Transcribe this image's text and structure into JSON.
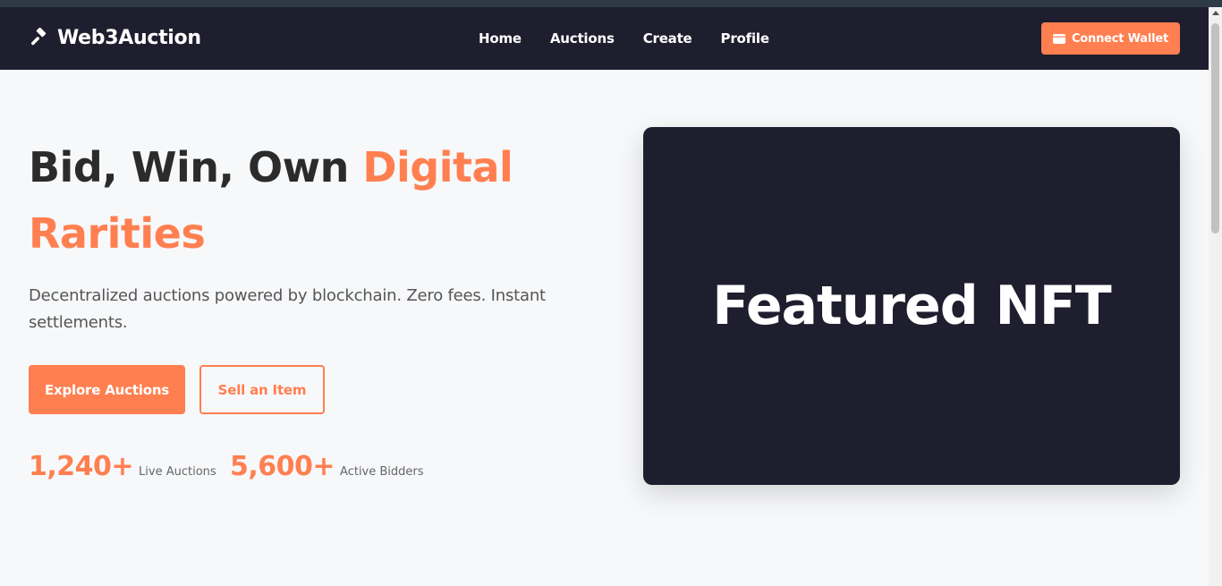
{
  "nav": {
    "brand": "Web3Auction",
    "links": [
      "Home",
      "Auctions",
      "Create",
      "Profile"
    ],
    "wallet_label": "Connect Wallet"
  },
  "hero": {
    "title_plain": "Bid, Win, Own ",
    "title_accent": "Digital Rarities",
    "subtitle": "Decentralized auctions powered by blockchain. Zero fees. Instant settlements.",
    "primary_label": "Explore Auctions",
    "secondary_label": "Sell an Item"
  },
  "stats": [
    {
      "value": "1,240+",
      "label": "Live Auctions"
    },
    {
      "value": "5,600+",
      "label": "Active Bidders"
    }
  ],
  "featured": {
    "label": "Featured NFT"
  },
  "icons": {
    "brand": "gavel-icon",
    "wallet": "wallet-icon"
  },
  "colors": {
    "accent": "#ff7f50",
    "dark": "#1f1e2f",
    "background": "#f7f8fa"
  }
}
